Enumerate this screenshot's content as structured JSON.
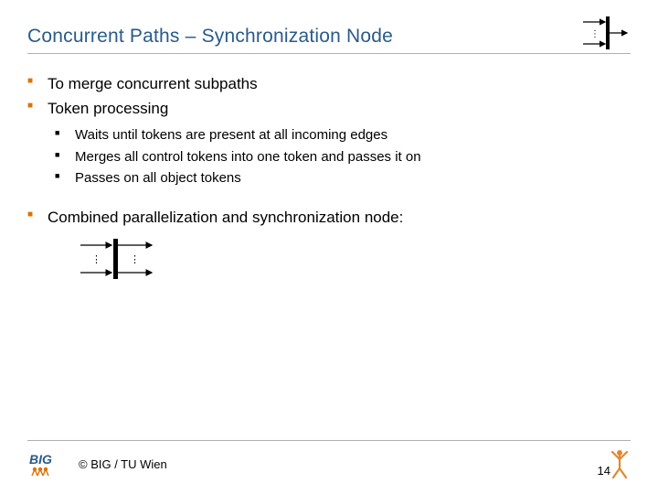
{
  "header": {
    "title": "Concurrent Paths – Synchronization Node"
  },
  "bullets": {
    "b1": "To merge concurrent subpaths",
    "b2": "Token processing",
    "b2_1": "Waits until tokens are present at all incoming edges",
    "b2_2": "Merges all control tokens into one token and passes it on",
    "b2_3": "Passes on all object tokens",
    "b3": "Combined parallelization and synchronization node:"
  },
  "footer": {
    "copyright": "© BIG / TU Wien",
    "page_number": "14"
  },
  "icons": {
    "sync_node": "synchronization-node-diagram",
    "combined_node": "combined-parallel-sync-node-diagram",
    "logo": "big-logo",
    "person": "person-icon"
  }
}
